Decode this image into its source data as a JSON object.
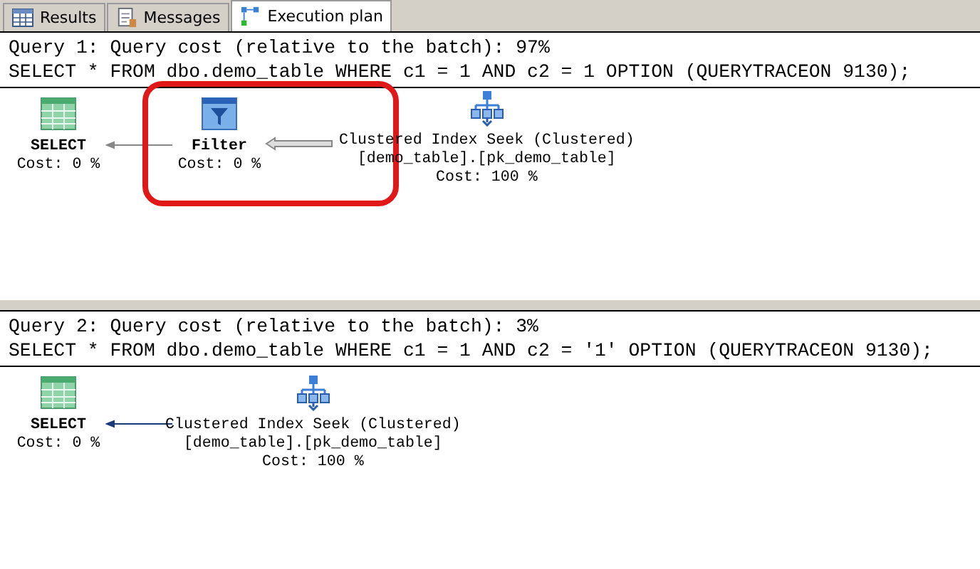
{
  "tabs": [
    {
      "label": "Results",
      "kind": "grid",
      "selected": false
    },
    {
      "label": "Messages",
      "kind": "messages",
      "selected": false
    },
    {
      "label": "Execution plan",
      "kind": "plan",
      "selected": true
    }
  ],
  "queries": [
    {
      "header": "Query 1: Query cost (relative to the batch): 97%",
      "sql": "SELECT * FROM dbo.demo_table WHERE c1 = 1 AND c2 = 1 OPTION (QUERYTRACEON 9130);",
      "nodes": [
        {
          "kind": "select",
          "lines": [
            "SELECT",
            "Cost: 0 %"
          ],
          "highlighted": false
        },
        {
          "kind": "filter",
          "lines": [
            "Filter",
            "Cost: 0 %"
          ],
          "highlighted": true
        },
        {
          "kind": "seek",
          "lines": [
            "Clustered Index Seek (Clustered)",
            "[demo_table].[pk_demo_table]",
            "Cost: 100 %"
          ],
          "highlighted": false
        }
      ]
    },
    {
      "header": "Query 2: Query cost (relative to the batch): 3%",
      "sql": "SELECT * FROM dbo.demo_table WHERE c1 = 1 AND c2 = '1' OPTION (QUERYTRACEON 9130);",
      "nodes": [
        {
          "kind": "select",
          "lines": [
            "SELECT",
            "Cost: 0 %"
          ],
          "highlighted": false
        },
        {
          "kind": "seek",
          "lines": [
            "Clustered Index Seek (Clustered)",
            "[demo_table].[pk_demo_table]",
            "Cost: 100 %"
          ],
          "highlighted": false
        }
      ]
    }
  ]
}
